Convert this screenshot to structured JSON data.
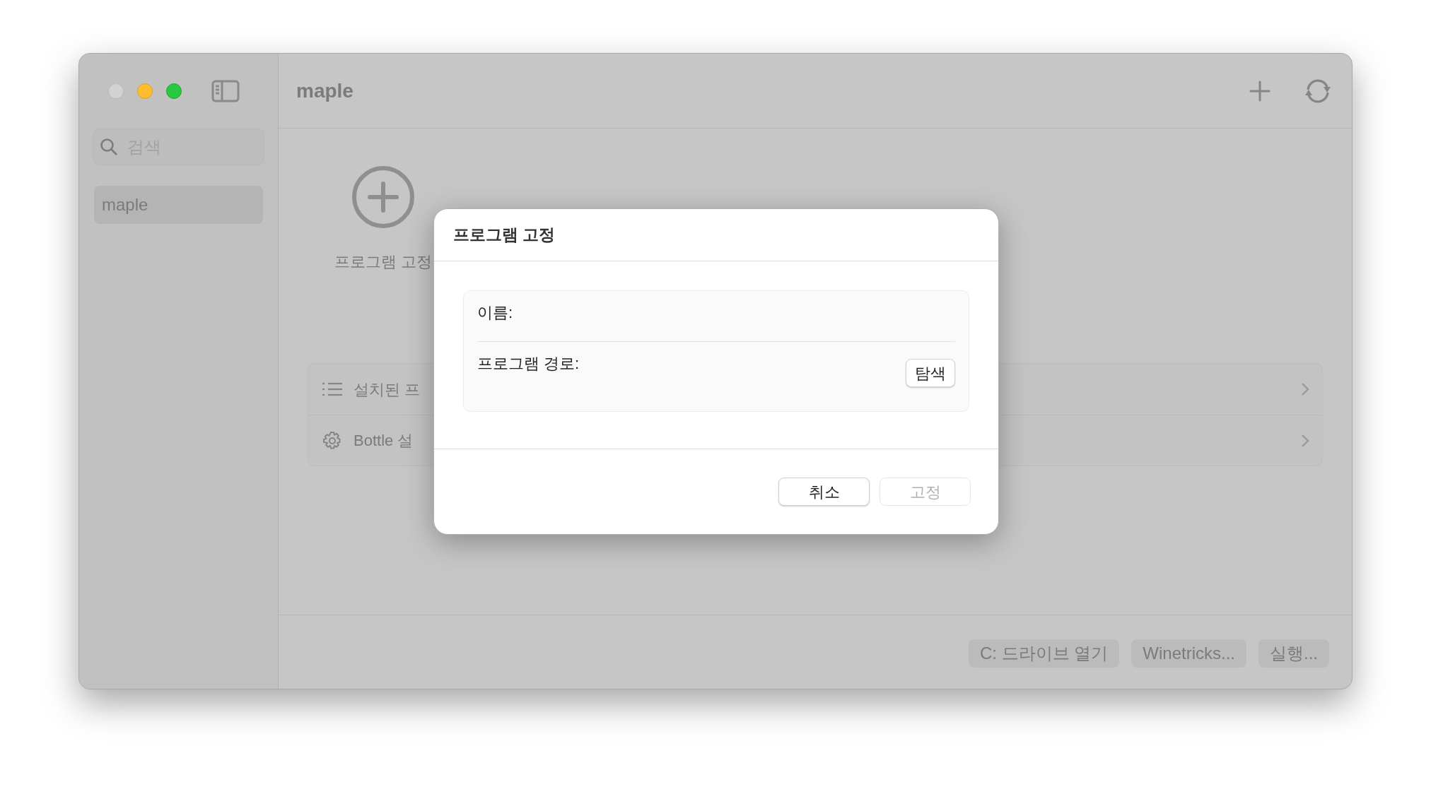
{
  "window": {
    "title": "maple",
    "traffic_lights": [
      {
        "kind": "close",
        "disabled": true
      },
      {
        "kind": "minimize",
        "disabled": false
      },
      {
        "kind": "zoom",
        "disabled": false
      }
    ]
  },
  "sidebar": {
    "search": {
      "placeholder": "검색"
    },
    "items": [
      {
        "label": "maple",
        "selected": true
      }
    ]
  },
  "main": {
    "pin_program": {
      "label": "프로그램 고정"
    },
    "rows": [
      {
        "kind": "list",
        "label": "설치된 프"
      },
      {
        "kind": "gear",
        "label": "Bottle 설"
      }
    ],
    "bottom_buttons": [
      "C: 드라이브 열기",
      "Winetricks...",
      "실행..."
    ]
  },
  "dialog": {
    "title": "프로그램 고정",
    "fields": [
      {
        "label": "이름:"
      },
      {
        "label": "프로그램 경로:",
        "button": "탐색"
      }
    ],
    "buttons": [
      {
        "label": "취소",
        "disabled": false
      },
      {
        "label": "고정",
        "disabled": true
      }
    ]
  }
}
